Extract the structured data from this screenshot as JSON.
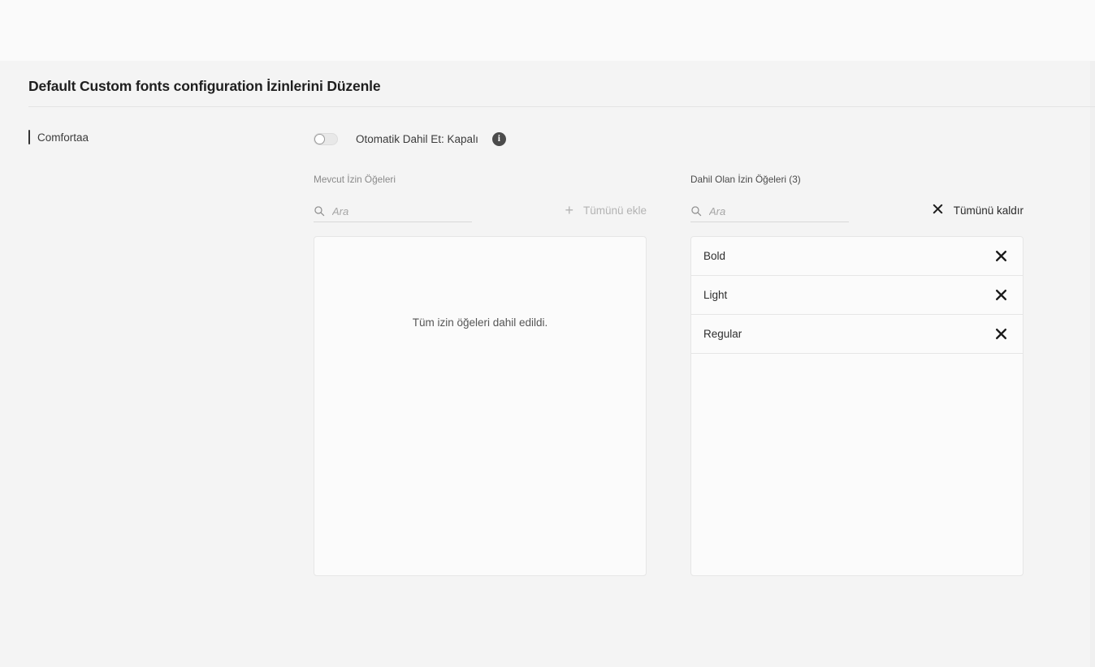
{
  "page": {
    "title": "Default Custom fonts configuration İzinlerini Düzenle"
  },
  "font_entry": {
    "name": "Comfortaa"
  },
  "auto_include": {
    "label": "Otomatik Dahil Et: Kapalı",
    "state": "off",
    "info_glyph": "i"
  },
  "available_panel": {
    "header": "Mevcut İzin Öğeleri",
    "search_placeholder": "Ara",
    "search_value": "",
    "bulk_action_label": "Tümünü ekle",
    "bulk_action_glyph": "+",
    "empty_message": "Tüm izin öğeleri dahil edildi.",
    "items": []
  },
  "included_panel": {
    "header": "Dahil Olan İzin Öğeleri (3)",
    "count": 3,
    "search_placeholder": "Ara",
    "search_value": "",
    "bulk_action_label": "Tümünü kaldır",
    "items": [
      {
        "label": "Bold"
      },
      {
        "label": "Light"
      },
      {
        "label": "Regular"
      }
    ]
  },
  "colors": {
    "page_background": "#f4f4f4",
    "top_strip": "#fafafa",
    "panel_background": "#fbfbfb",
    "border": "#e6e6e6",
    "muted_text": "#8a8a8a",
    "disabled_text": "#b3b3b3",
    "primary_text": "#1f1f1f"
  }
}
